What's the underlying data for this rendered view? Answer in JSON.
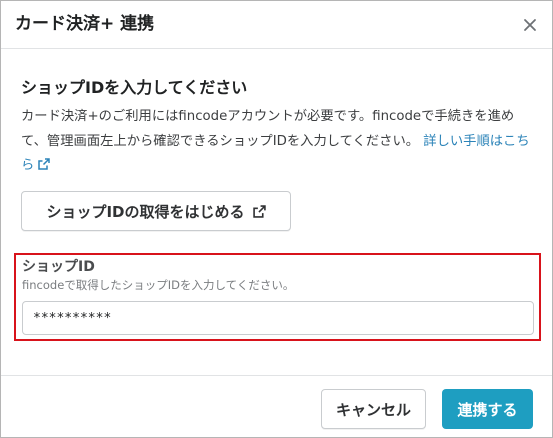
{
  "dialog": {
    "title": "カード決済+ 連携",
    "close_icon": "close-icon"
  },
  "content": {
    "heading": "ショップIDを入力してください",
    "description": "カード決済+のご利用にはfincodeアカウントが必要です。fincodeで手続きを進めて、管理画面左上から確認できるショップIDを入力してください。",
    "details_link": "詳しい手順はこちら",
    "external_link_icon": "external-link-icon",
    "start_button_label": "ショップIDの取得をはじめる"
  },
  "shop_id_field": {
    "label": "ショップID",
    "help_text": "fincodeで取得したショップIDを入力してください。",
    "value": "**********"
  },
  "footer": {
    "cancel_label": "キャンセル",
    "connect_label": "連携する"
  },
  "colors": {
    "primary": "#1e9ec1",
    "link": "#2b83b8",
    "highlight_border": "#d8131b"
  }
}
